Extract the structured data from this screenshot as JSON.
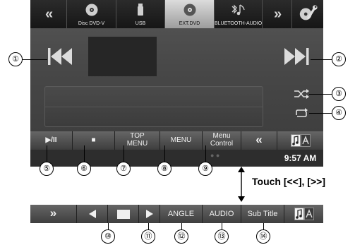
{
  "source_bar": {
    "left_arrow": "«",
    "right_arrow": "»",
    "sources": [
      {
        "label": "Disc DVD-V",
        "icon": "disc-icon",
        "active": false
      },
      {
        "label": "USB",
        "icon": "usb-icon",
        "active": false
      },
      {
        "label": "EXT.DVD",
        "icon": "disc-icon",
        "active": true
      },
      {
        "label": "BLUETOOTH-AUDIO",
        "icon": "bluetooth-audio-icon",
        "active": false
      }
    ],
    "settings_icon": "disc-wrench-icon"
  },
  "controls": {
    "prev_icon": "skip-previous-icon",
    "next_icon": "skip-next-icon",
    "shuffle_icon": "shuffle-icon",
    "repeat_icon": "repeat-icon"
  },
  "bottom_bar": {
    "play_pause": "▶/II",
    "stop": "■",
    "top_menu_line1": "TOP",
    "top_menu_line2": "MENU",
    "menu": "MENU",
    "menu_control_line1": "Menu",
    "menu_control_line2": "Control",
    "toggle": "«",
    "clock": "9:57 AM",
    "dots": "● ●"
  },
  "touch_label": "Touch [<<], [>>]",
  "alt_bar": {
    "toggle": "»",
    "angle": "ANGLE",
    "audio": "AUDIO",
    "subtitle": "Sub Title"
  },
  "callouts": [
    "①",
    "②",
    "③",
    "④",
    "⑤",
    "⑥",
    "⑦",
    "⑧",
    "⑨",
    "⑩",
    "⑪",
    "⑫",
    "⑬",
    "⑭"
  ]
}
